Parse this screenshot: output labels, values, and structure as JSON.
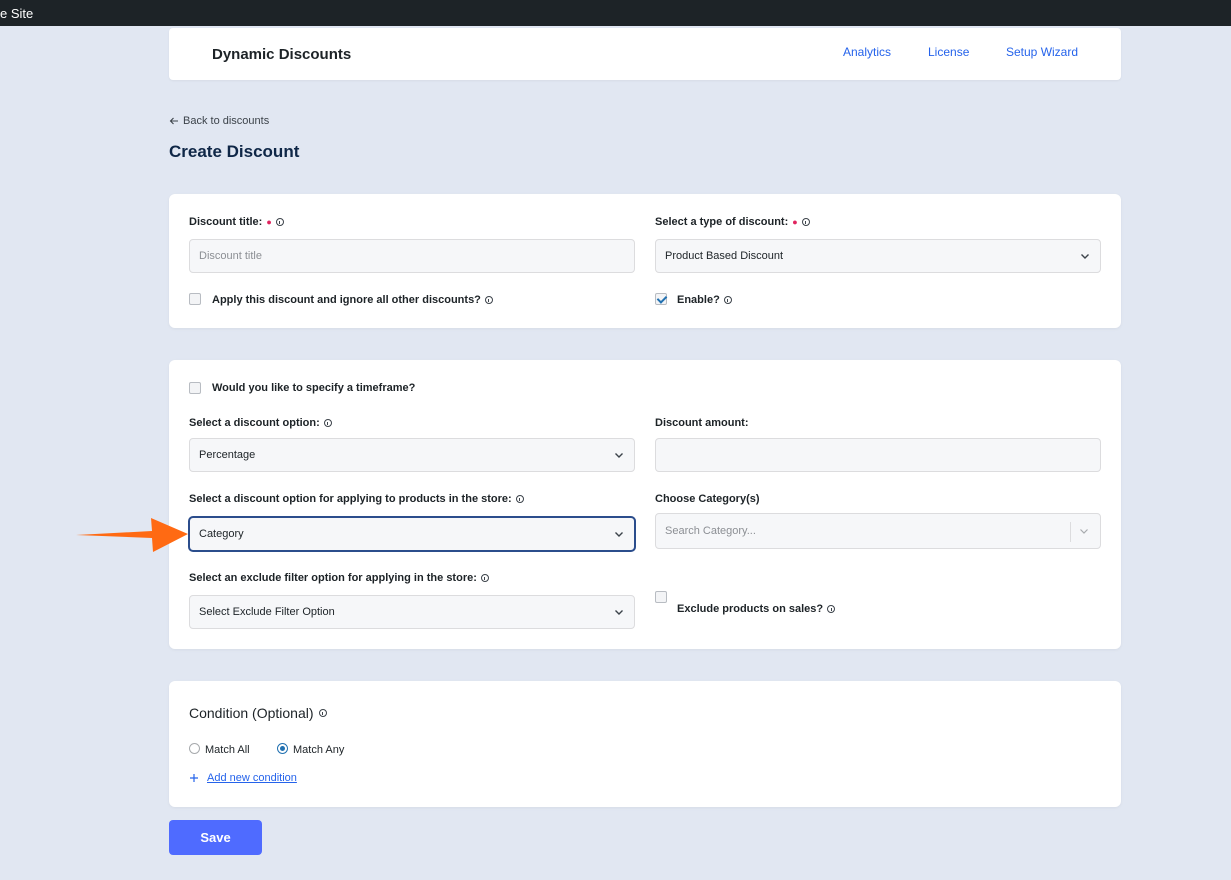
{
  "adminbar": {
    "site_label": "e Site"
  },
  "header": {
    "brand": "Dynamic Discounts",
    "nav": [
      "Analytics",
      "License",
      "Setup Wizard"
    ]
  },
  "page": {
    "back_label": "Back to discounts",
    "title": "Create Discount"
  },
  "general": {
    "title_label": "Discount title:",
    "title_placeholder": "Discount title",
    "type_label": "Select a type of discount:",
    "type_value": "Product Based Discount",
    "ignore_label": "Apply this discount and ignore all other discounts?",
    "ignore_checked": false,
    "enable_label": "Enable?",
    "enable_checked": true
  },
  "rules": {
    "timeframe_label": "Would you like to specify a timeframe?",
    "timeframe_checked": false,
    "option_label": "Select a discount option:",
    "option_value": "Percentage",
    "amount_label": "Discount amount:",
    "amount_value": "",
    "apply_label": "Select a discount option for applying to products in the store:",
    "apply_value": "Category",
    "category_label": "Choose Category(s)",
    "category_placeholder": "Search Category...",
    "exclude_label": "Select an exclude filter option for applying in the store:",
    "exclude_value": "Select Exclude Filter Option",
    "sales_label": "Exclude products on sales?",
    "sales_checked": false
  },
  "condition": {
    "title": "Condition (Optional)",
    "match_all": "Match All",
    "match_any": "Match Any",
    "selected": "Match Any",
    "add_label": "Add new condition"
  },
  "save_label": "Save",
  "colors": {
    "accent": "#4f6bff",
    "link": "#2563eb",
    "arrow": "#ff6a13",
    "background": "#e1e7f2"
  }
}
